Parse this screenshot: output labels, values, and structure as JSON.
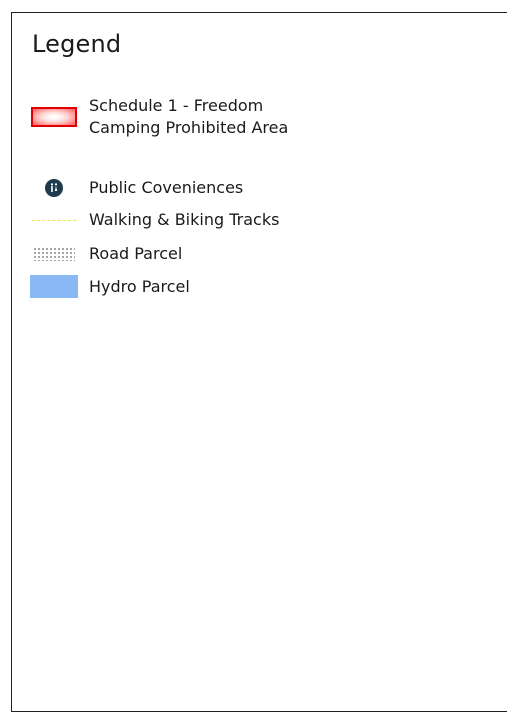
{
  "legend": {
    "title": "Legend",
    "items": [
      {
        "label": "Schedule 1 - Freedom Camping Prohibited Area",
        "symbol": "red-outlined-gradient-rectangle",
        "color": "#e00000"
      },
      {
        "label": "Public Coveniences",
        "symbol": "toilet-icon",
        "color": "#1f3a4d"
      },
      {
        "label": "Walking & Biking Tracks",
        "symbol": "dashed-yellow-line",
        "color": "#e9e84a"
      },
      {
        "label": "Road Parcel",
        "symbol": "dot-pattern",
        "color": "#555555"
      },
      {
        "label": "Hydro Parcel",
        "symbol": "blue-fill",
        "color": "#8ab8f5"
      }
    ]
  }
}
